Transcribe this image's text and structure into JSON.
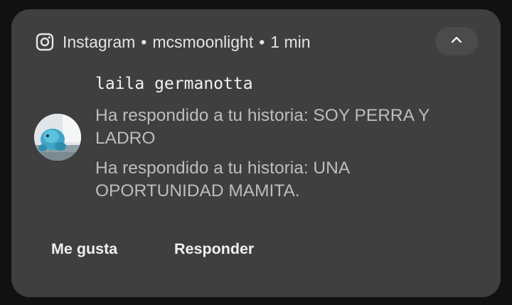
{
  "notification": {
    "app_name": "Instagram",
    "separator": "•",
    "account": "mcsmoonlight",
    "time": "1 min",
    "sender": "laila germanotta",
    "messages": [
      "Ha respondido a tu historia: SOY PERRA Y LADRO",
      "Ha respondido a tu historia: UNA OPORTUNIDAD MAMITA."
    ],
    "actions": {
      "like_label": "Me gusta",
      "reply_label": "Responder"
    },
    "icons": {
      "app": "instagram-icon",
      "collapse": "chevron-up-icon"
    },
    "colors": {
      "card_background": "#3f3f3f",
      "page_background": "#111111",
      "text_primary": "#f2f2f2",
      "text_secondary": "#bdbdbd"
    }
  }
}
